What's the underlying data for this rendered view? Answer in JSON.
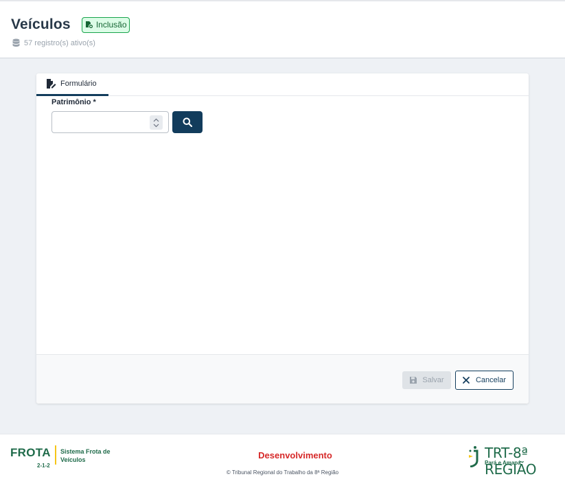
{
  "header": {
    "title": "Veículos",
    "badge": "Inclusão",
    "subtitle": "57 registro(s) ativo(s)"
  },
  "tabs": [
    {
      "label": "Formulário",
      "icon": "file-edit-icon",
      "active": true
    }
  ],
  "form": {
    "patrimonio_label": "Patrimônio *",
    "patrimonio_value": "",
    "search_icon": "search-icon"
  },
  "actions": {
    "save_label": "Salvar",
    "cancel_label": "Cancelar"
  },
  "footer": {
    "system_name": "FROTA",
    "system_version": "2-1-2",
    "system_description": "Sistema Frota de Veículos",
    "environment": "Desenvolvimento",
    "copyright": "© Tribunal Regional do Trabalho da 8ª Região",
    "org_logo_text": "TRT-8ª REGIÃO",
    "org_logo_sub": "Pará e Amapá"
  },
  "colors": {
    "primary": "#123c5c",
    "success_badge_bg": "#dcfce7",
    "success_badge_border": "#16a34a",
    "environment_text": "#d62828",
    "brand_green": "#1f6b4a"
  }
}
